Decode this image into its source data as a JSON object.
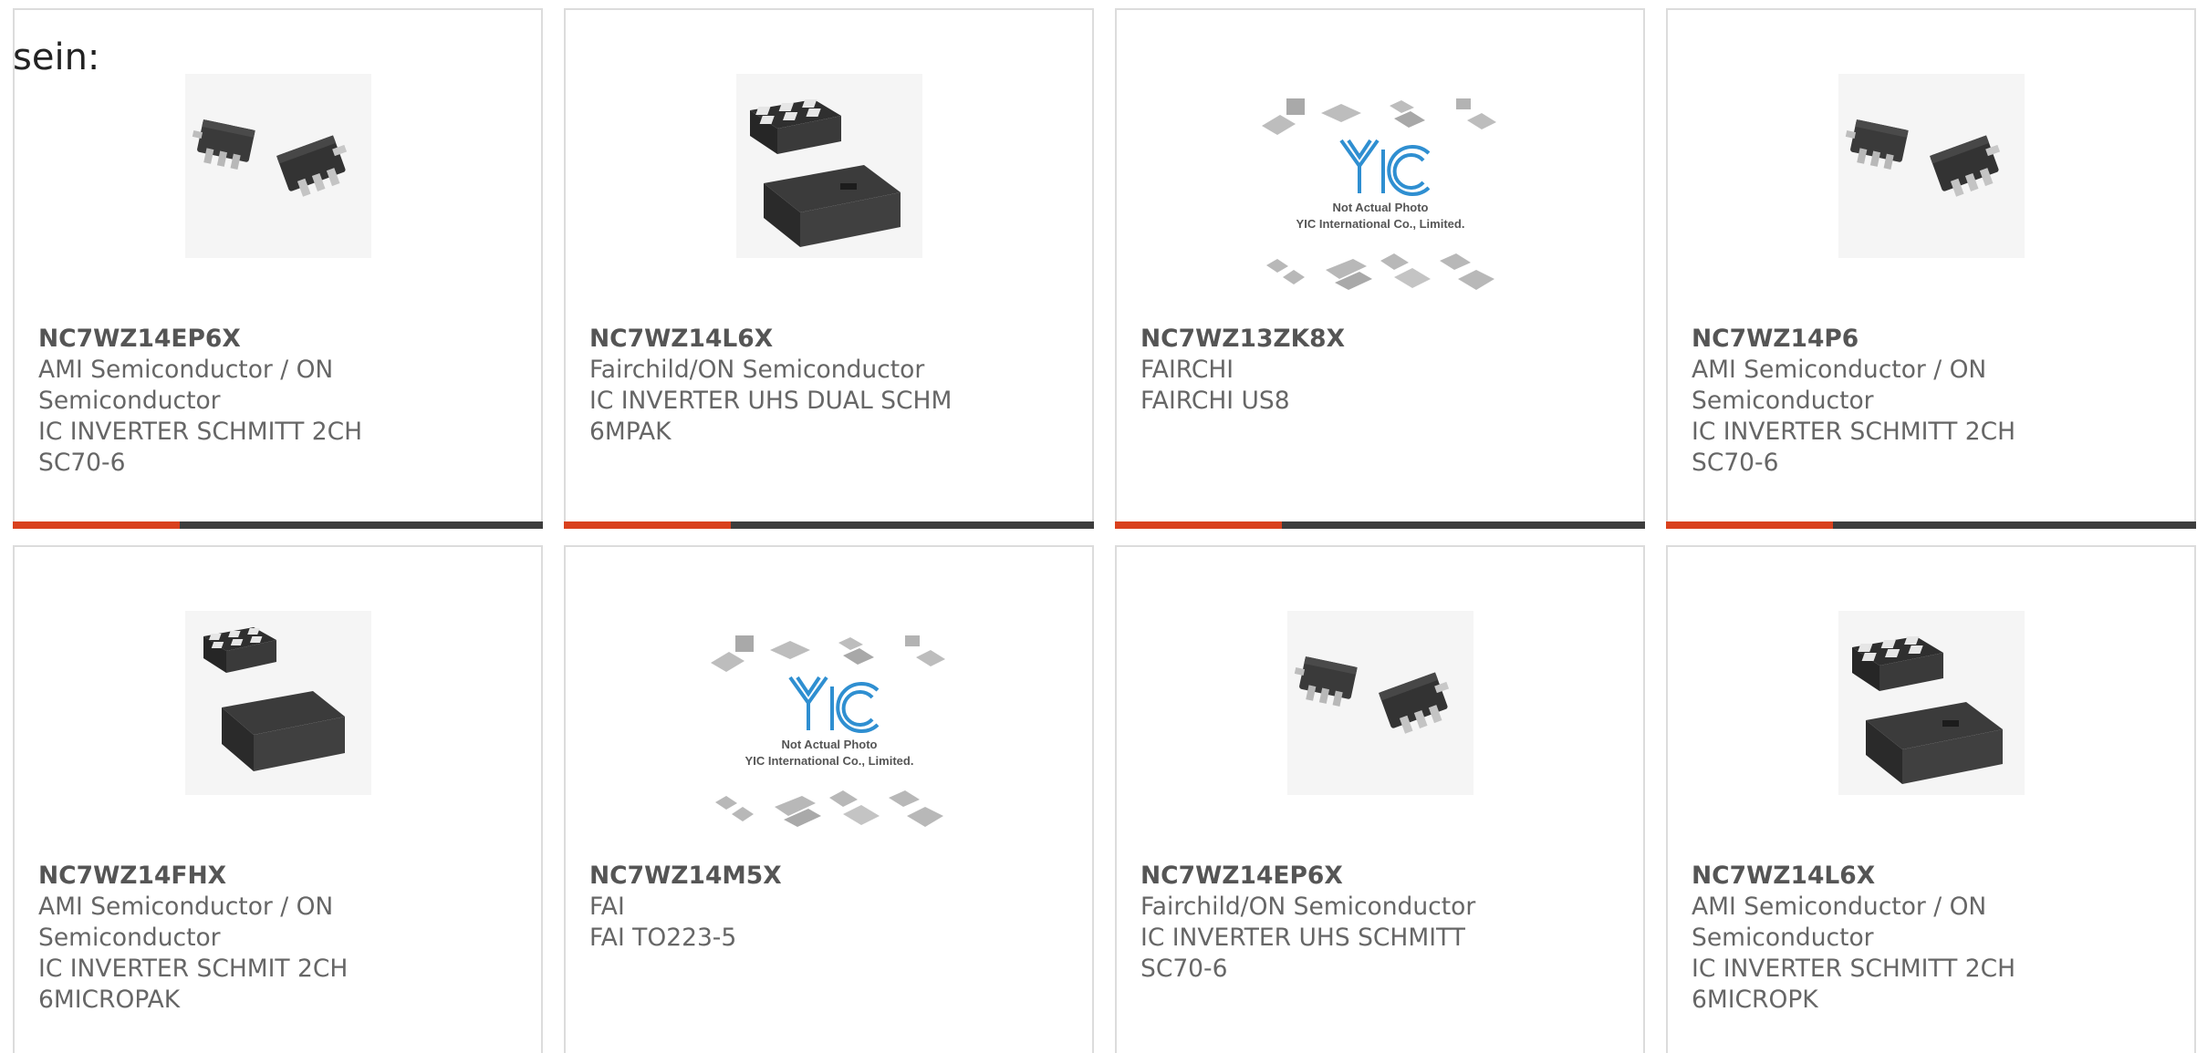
{
  "lead": "sein:",
  "colors": {
    "accent_red": "#d9411e",
    "accent_dark": "#3d3d3d",
    "card_border": "#dcdcdc",
    "text": "#666666"
  },
  "placeholder": {
    "line1": "Not Actual Photo",
    "line2": "YIC International Co., Limited.",
    "logo": "YIC"
  },
  "cards": [
    {
      "part": "NC7WZ14EP6X",
      "manufacturer": "AMI Semiconductor / ON Semiconductor",
      "desc_line1": "IC INVERTER SCHMITT 2CH",
      "desc_line2": "SC70-6",
      "image": "sc70-package-icon"
    },
    {
      "part": "NC7WZ14L6X",
      "manufacturer": "Fairchild/ON Semiconductor",
      "desc_line1": "IC INVERTER UHS DUAL SCHM",
      "desc_line2": "6MPAK",
      "image": "micropak-package-icon"
    },
    {
      "part": "NC7WZ13ZK8X",
      "manufacturer": "FAIRCHI",
      "desc_line1": "FAIRCHI US8",
      "desc_line2": "",
      "image": "not-actual-photo-placeholder"
    },
    {
      "part": "NC7WZ14P6",
      "manufacturer": "AMI Semiconductor / ON Semiconductor",
      "desc_line1": "IC INVERTER SCHMITT 2CH",
      "desc_line2": "SC70-6",
      "image": "sc70-package-icon"
    },
    {
      "part": "NC7WZ14FHX",
      "manufacturer": "AMI Semiconductor / ON Semiconductor",
      "desc_line1": "IC INVERTER SCHMIT 2CH",
      "desc_line2": "6MICROPAK",
      "image": "micropak-package-icon"
    },
    {
      "part": "NC7WZ14M5X",
      "manufacturer": "FAI",
      "desc_line1": "FAI TO223-5",
      "desc_line2": "",
      "image": "not-actual-photo-placeholder"
    },
    {
      "part": "NC7WZ14EP6X",
      "manufacturer": "Fairchild/ON Semiconductor",
      "desc_line1": "IC INVERTER UHS SCHMITT",
      "desc_line2": "SC70-6",
      "image": "sc70-package-icon"
    },
    {
      "part": "NC7WZ14L6X",
      "manufacturer": "AMI Semiconductor / ON Semiconductor",
      "desc_line1": "IC INVERTER SCHMITT 2CH",
      "desc_line2": "6MICROPK",
      "image": "micropak-package-icon"
    }
  ]
}
